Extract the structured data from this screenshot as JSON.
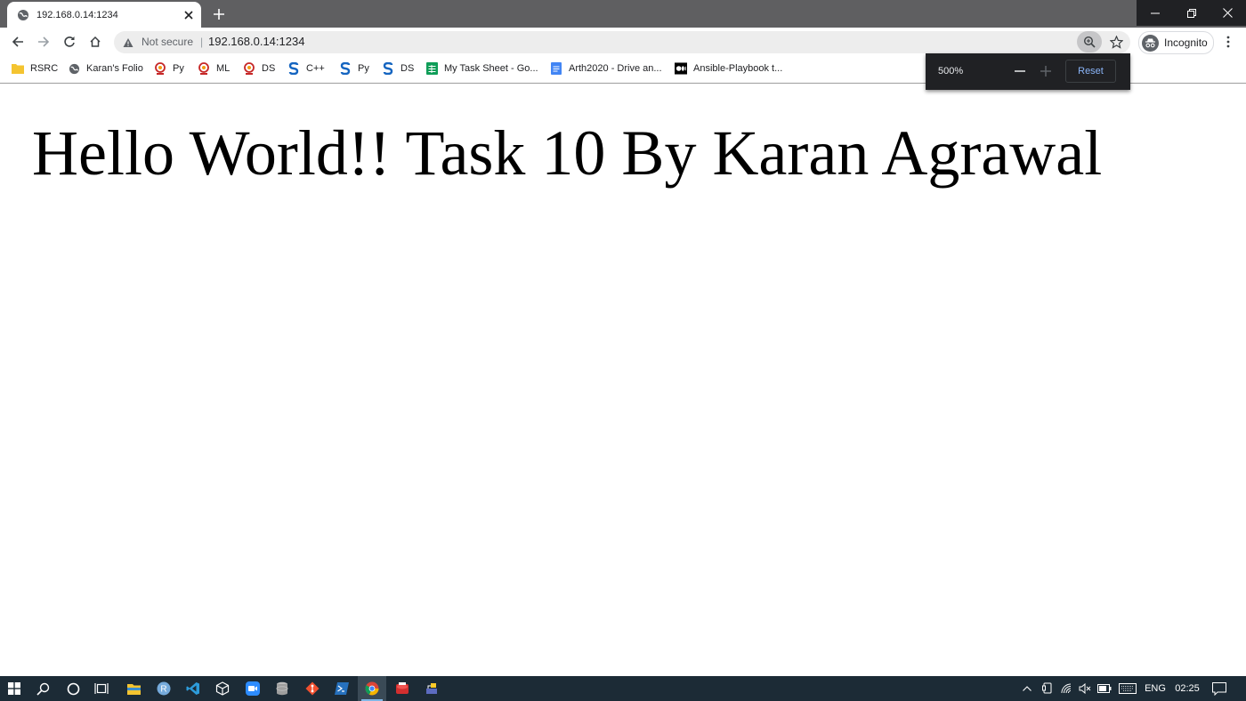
{
  "browser": {
    "tab": {
      "title": "192.168.0.14:1234"
    },
    "omnibox": {
      "security_label": "Not secure",
      "separator": "|",
      "url": "192.168.0.14:1234"
    },
    "profile_label": "Incognito",
    "zoom_popup": {
      "level": "500%",
      "reset_label": "Reset"
    }
  },
  "bookmarks": [
    {
      "label": "RSRC",
      "icon": "folder-icon"
    },
    {
      "label": "Karan's Folio",
      "icon": "globe-icon"
    },
    {
      "label": "Py",
      "icon": "site-icon"
    },
    {
      "label": "ML",
      "icon": "site-icon"
    },
    {
      "label": "DS",
      "icon": "site-icon"
    },
    {
      "label": "C++",
      "icon": "s-logo-icon"
    },
    {
      "label": "Py",
      "icon": "s-logo-icon"
    },
    {
      "label": "DS",
      "icon": "s-logo-icon"
    },
    {
      "label": "My Task Sheet - Go...",
      "icon": "sheets-icon"
    },
    {
      "label": "Arth2020 - Drive an...",
      "icon": "docs-icon"
    },
    {
      "label": "Ansible-Playbook t...",
      "icon": "medium-icon"
    }
  ],
  "page": {
    "heading": "Hello World!! Task 10 By Karan Agrawal"
  },
  "taskbar": {
    "language": "ENG",
    "time": "02:25"
  },
  "colors": {
    "tabstrip": "#5f5f61",
    "taskbar": "#1c2b36",
    "zoom_popup": "#202124",
    "reset_text": "#8ab4f8"
  }
}
